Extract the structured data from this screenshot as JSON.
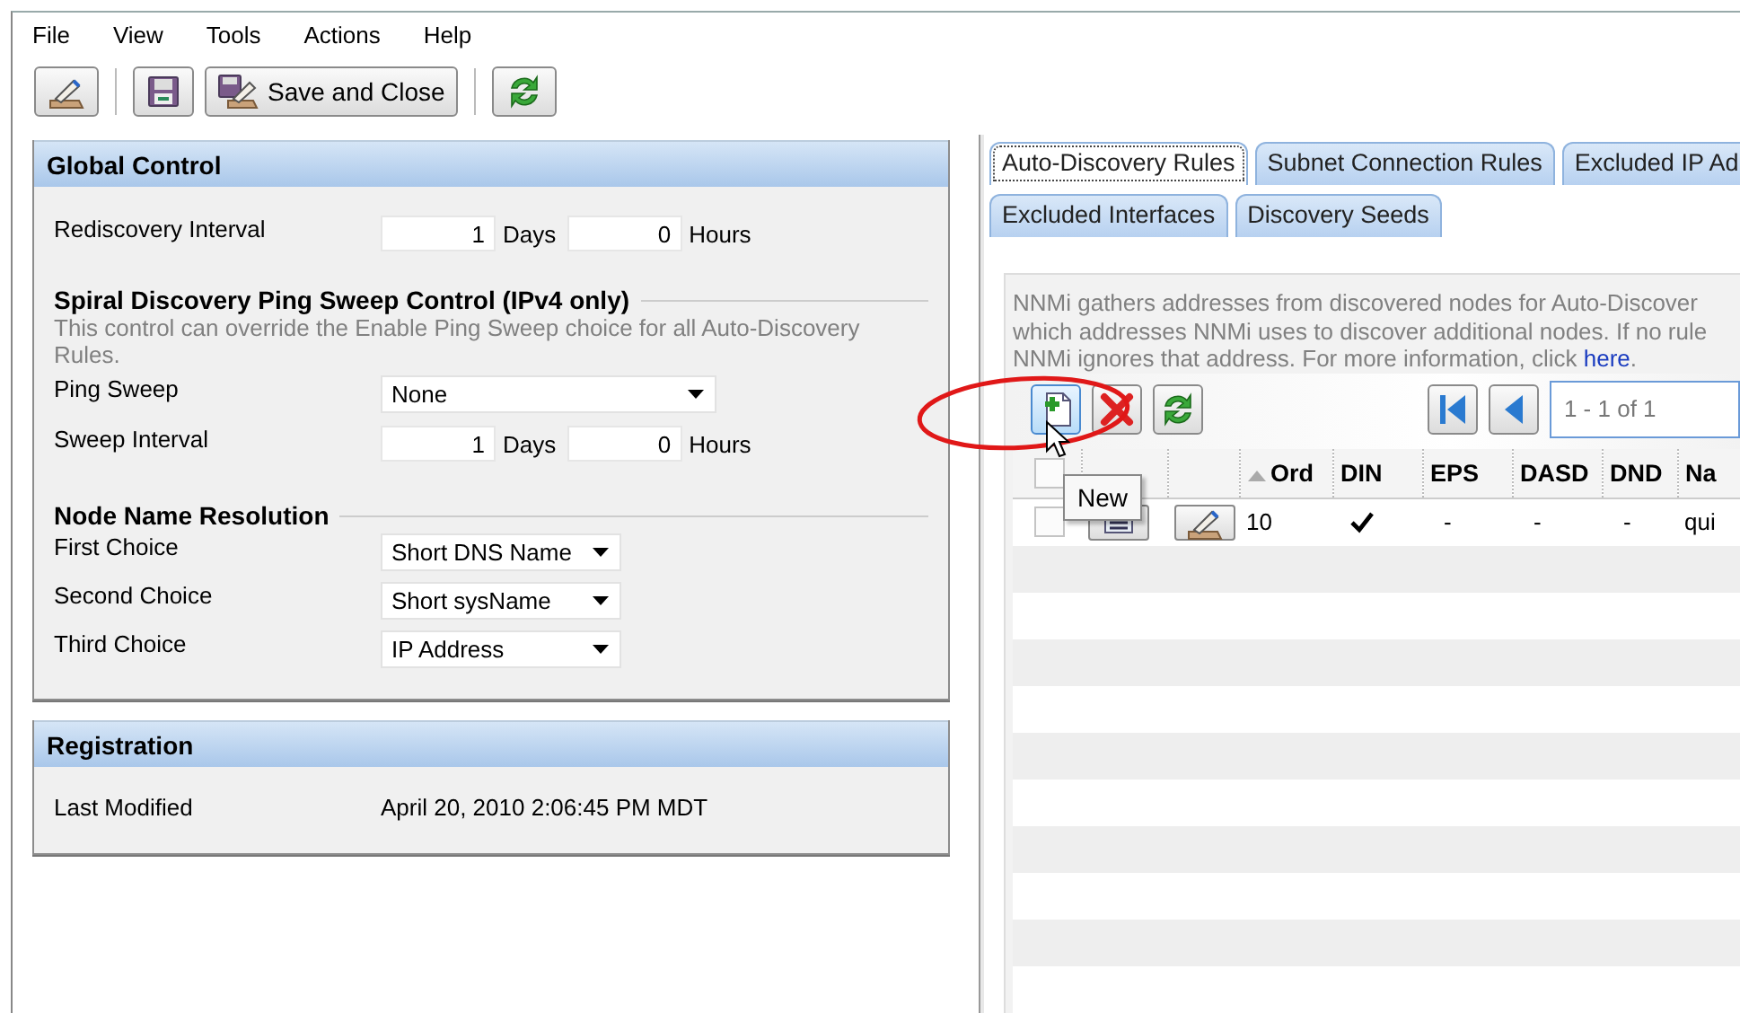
{
  "menu": [
    "File",
    "View",
    "Tools",
    "Actions",
    "Help"
  ],
  "toolbar": {
    "save_and_close": "Save and Close"
  },
  "global_control": {
    "title": "Global Control",
    "rediscovery_interval": {
      "label": "Rediscovery Interval",
      "days": "1",
      "days_unit": "Days",
      "hours": "0",
      "hours_unit": "Hours"
    },
    "ping_sweep_control": {
      "title": "Spiral Discovery Ping Sweep Control (IPv4 only)",
      "note": "This control can override the Enable Ping Sweep choice for all Auto-Discovery Rules.",
      "ping_sweep": {
        "label": "Ping Sweep",
        "value": "None"
      },
      "sweep_interval": {
        "label": "Sweep Interval",
        "days": "1",
        "days_unit": "Days",
        "hours": "0",
        "hours_unit": "Hours"
      }
    },
    "node_name_resolution": {
      "title": "Node Name Resolution",
      "choices": [
        {
          "label": "First Choice",
          "value": "Short DNS Name"
        },
        {
          "label": "Second Choice",
          "value": "Short sysName"
        },
        {
          "label": "Third Choice",
          "value": "IP Address"
        }
      ]
    }
  },
  "registration": {
    "title": "Registration",
    "last_modified": {
      "label": "Last Modified",
      "value": "April 20, 2010 2:06:45 PM MDT"
    }
  },
  "tab_rows": [
    [
      {
        "label": "Auto-Discovery Rules",
        "selected": true
      },
      {
        "label": "Subnet Connection Rules",
        "selected": false
      },
      {
        "label": "Excluded IP Ad",
        "selected": false
      }
    ],
    [
      {
        "label": "Excluded Interfaces",
        "selected": false
      },
      {
        "label": "Discovery Seeds",
        "selected": false
      }
    ]
  ],
  "rules": {
    "description_lines": [
      "NNMi gathers addresses from discovered nodes for Auto-Discover",
      "which addresses NNMi uses to discover additional nodes. If no rule",
      "NNMi ignores that address. For more information, click "
    ],
    "link": "here",
    "after_link": ".",
    "paging": "1 - 1 of 1",
    "tooltip": "New",
    "header_checked": false,
    "columns": [
      {
        "label": "Ord",
        "sorted": true
      },
      {
        "label": "DIN",
        "sorted": false
      },
      {
        "label": "EPS",
        "sorted": false
      },
      {
        "label": "DASD",
        "sorted": false
      },
      {
        "label": "DND",
        "sorted": false
      },
      {
        "label": "Na",
        "sorted": false
      }
    ],
    "rows": [
      {
        "checked": false,
        "order": "10",
        "din": true,
        "eps": "-",
        "dasd": "-",
        "dnd": "-",
        "name": "qui"
      }
    ]
  }
}
